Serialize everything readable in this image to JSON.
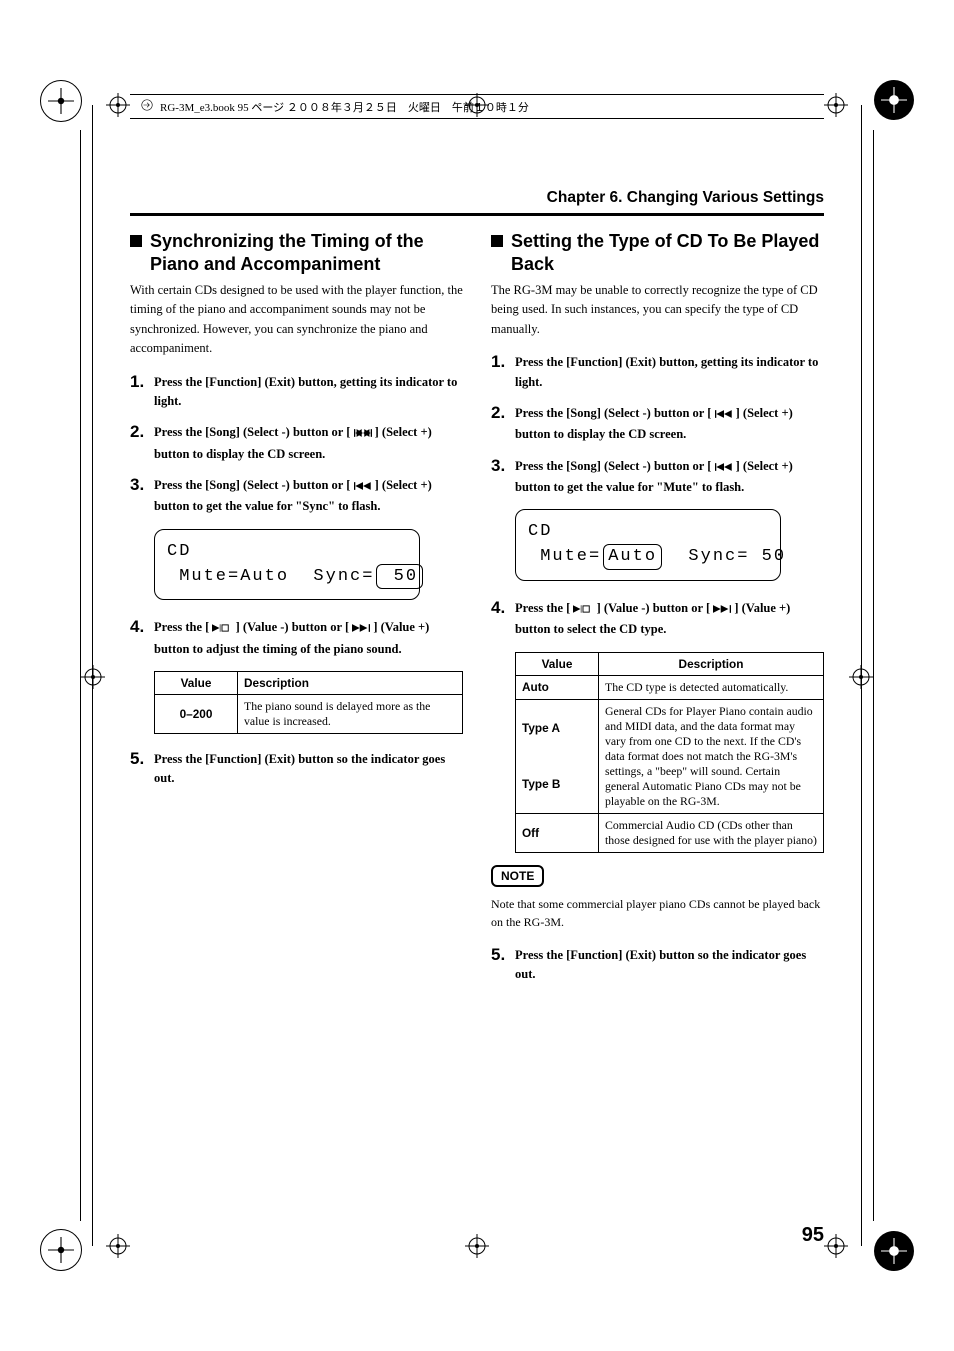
{
  "runningHeader": "RG-3M_e3.book 95 ページ ２００８年３月２５日　火曜日　午前１０時１分",
  "chapterTitle": "Chapter 6. Changing Various Settings",
  "pageNumber": "95",
  "left": {
    "heading": "Synchronizing the Timing of the Piano and Accompaniment",
    "intro": "With certain CDs designed to be used with the player function, the timing of the piano and accompaniment sounds may not be synchronized. However, you can synchronize the piano and accompaniment.",
    "steps": {
      "s1": "Press the [Function] (Exit) button, getting its indicator to light.",
      "s2a": "Press the [Song] (Select -) button or [ ",
      "s2b": " ] (Select +) button to display the CD screen.",
      "s3a": "Press the [Song] (Select -) button or [ ",
      "s3b": " ] (Select +) button to get the value for \"Sync\" to flash.",
      "s4a": "Press the [ ",
      "s4b": " ] (Value -) button or [ ",
      "s4c": " ] (Value +) button to adjust the timing of the piano sound.",
      "s5": "Press the [Function] (Exit) button so the indicator goes out."
    },
    "lcd": {
      "line1": "CD",
      "line2a": " Mute=Auto  Sync=",
      "line2box": " 50"
    },
    "table": {
      "h1": "Value",
      "h2": "Description",
      "r1v": "0–200",
      "r1d": "The piano sound is delayed more as the value is increased."
    }
  },
  "right": {
    "heading": "Setting the Type of CD To Be Played Back",
    "intro": "The RG-3M may be unable to correctly recognize the type of CD being used. In such instances, you can specify the type of CD manually.",
    "steps": {
      "s1": "Press the [Function] (Exit) button, getting its indicator to light.",
      "s2a": "Press the [Song] (Select -) button or [ ",
      "s2b": " ] (Select +) button to display the CD screen.",
      "s3a": "Press the [Song] (Select -) button or [ ",
      "s3b": " ] (Select +) button to get the value for \"Mute\" to flash.",
      "s4a": "Press the [ ",
      "s4b": " ] (Value -) button or [ ",
      "s4c": " ] (Value +) button to select the CD type.",
      "s5": "Press the [Function] (Exit) button so the indicator goes out."
    },
    "lcd": {
      "line1": "CD",
      "line2a": " Mute=",
      "line2box": "Auto",
      "line2b": "  Sync= 50"
    },
    "table": {
      "h1": "Value",
      "h2": "Description",
      "rows": [
        {
          "v": "Auto",
          "d": "The CD type is detected automatically."
        },
        {
          "v": "Type A",
          "d": "General CDs for Player Piano contain audio and MIDI data, and the data format may vary from one CD to the next. If the CD's data format does not match the RG-3M's settings, a \"beep\" will sound. Certain general Automatic Piano CDs may not be playable on the RG-3M."
        },
        {
          "v": "Type B",
          "d": ""
        },
        {
          "v": "Off",
          "d": "Commercial Audio CD (CDs other than those designed for use with the player piano)"
        }
      ]
    },
    "noteLabel": "NOTE",
    "noteText": "Note that some commercial player piano CDs cannot be played back on the RG-3M."
  }
}
